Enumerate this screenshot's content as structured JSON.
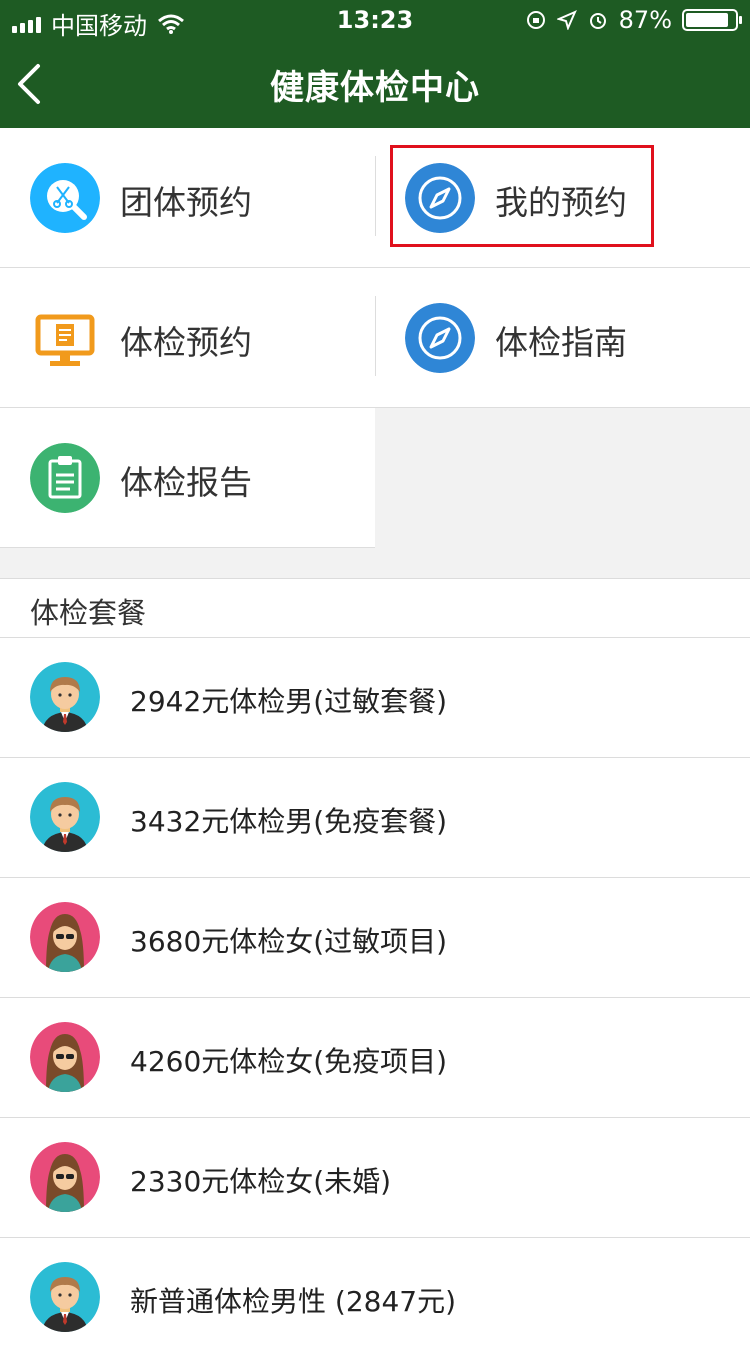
{
  "status_bar": {
    "carrier": "中国移动",
    "time": "13:23",
    "battery": "87%",
    "battery_level": 0.87
  },
  "nav": {
    "title": "健康体检中心",
    "back_icon": "chevron-left-icon"
  },
  "menu": [
    {
      "label": "团体预约",
      "icon": "scissors-magnifier-icon",
      "color": "#1fb3ff"
    },
    {
      "label": "我的预约",
      "icon": "compass-icon",
      "color": "#2f86d6"
    },
    {
      "label": "体检预约",
      "icon": "monitor-icon",
      "color": "#f19a1c"
    },
    {
      "label": "体检指南",
      "icon": "compass-icon",
      "color": "#2f86d6"
    },
    {
      "label": "体检报告",
      "icon": "clipboard-report-icon",
      "color": "#3cb371"
    }
  ],
  "section": {
    "title": "体检套餐"
  },
  "packages": [
    {
      "label": "2942元体检男(过敏套餐)",
      "avatar": "male-avatar-icon"
    },
    {
      "label": "3432元体检男(免疫套餐)",
      "avatar": "male-avatar-icon"
    },
    {
      "label": "3680元体检女(过敏项目)",
      "avatar": "female-avatar-icon"
    },
    {
      "label": "4260元体检女(免疫项目)",
      "avatar": "female-avatar-icon"
    },
    {
      "label": "2330元体检女(未婚)",
      "avatar": "female-avatar-icon"
    },
    {
      "label": "新普通体检男性 (2847元)",
      "avatar": "male-avatar-icon"
    }
  ],
  "colors": {
    "header": "#1e5b23",
    "highlight_border": "#e0101c",
    "male_avatar_bg": "#2bbcd4",
    "female_avatar_bg": "#e84b7a"
  }
}
